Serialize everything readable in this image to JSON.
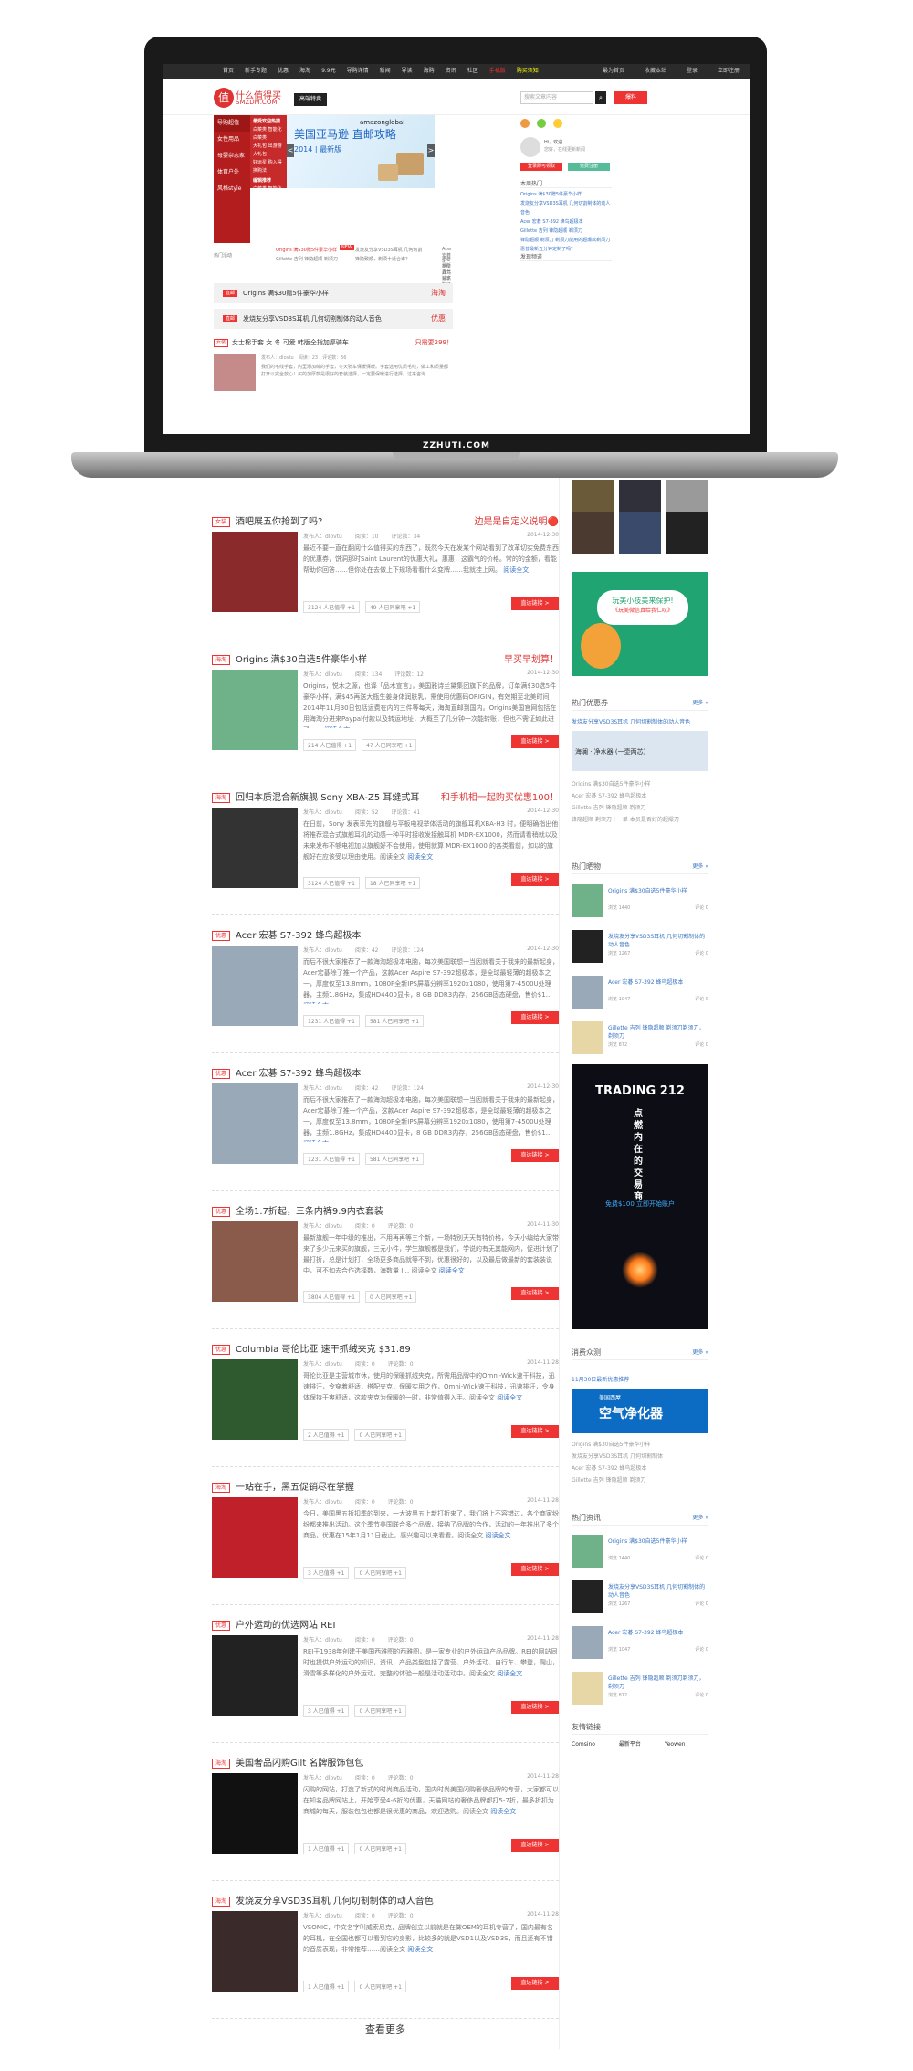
{
  "site": {
    "laptop_brand": "ZZHUTI.COM",
    "logo_name": "什么值得买",
    "logo_url_text": "SMZDM.COM",
    "banner_ad": "高端特卖"
  },
  "topnav": {
    "items": [
      "首页",
      "新手专题",
      "优惠",
      "海淘",
      "9.9元",
      "导购详情",
      "新闻",
      "导读",
      "海购",
      "资讯",
      "社区",
      "手机版",
      "购买须知"
    ],
    "right": [
      "最为首页",
      "收藏本站",
      "登录",
      "立即注册"
    ]
  },
  "search": {
    "placeholder": "搜索文章内容",
    "btn_label": "搜索",
    "post_label": "爆料"
  },
  "categories": [
    "导购超值",
    "女性用品",
    "母婴杂志家",
    "体育户外",
    "风格style"
  ],
  "cat_panel": {
    "title1": "最受欢迎热搜",
    "items1": [
      "白菜类",
      "智能化",
      "白菜类",
      "大礼包",
      "出游游",
      "大礼包",
      "好运星",
      "购入得",
      "换购法"
    ],
    "title2": "编辑推荐",
    "items2": [
      "白菜类",
      "智能化",
      "白菜类",
      "大礼包",
      "出游游",
      "大礼包",
      "好运星",
      "购入得",
      "换购法"
    ]
  },
  "slider": {
    "brand": "amazonglobal",
    "title": "美国亚马逊 直邮攻略",
    "subtitle": "2014 | 最新版",
    "prev": "<",
    "next": ">"
  },
  "sub_row": {
    "label": "热门活动",
    "items": [
      "Origins 满$30赠5件豪华小样",
      "发烧友分享VSD3S耳机 几何切割",
      "Acer 宏碁 S7-392 蜂鸟超极本",
      "Gillette 吉列 锋隐超顺 剃须刀",
      "锋隐致顺，剃须十适合谁？",
      "惠普最新五分钟定制了吗？"
    ],
    "new_badge": "NEW"
  },
  "strips": [
    {
      "tag": "直邮",
      "text": "Origins 满$30赠5件豪华小样",
      "right": "海淘"
    },
    {
      "tag": "直邮",
      "text": "发烧友分享VSD3S耳机 几何切割制体的动人音色",
      "right": "优惠"
    }
  ],
  "screen_article": {
    "tag": "女装",
    "title": "女士棉手套 女 冬 可爱 韩版全指加厚骑车",
    "price": "只需要299！",
    "meta": [
      "发布人：dlovtu",
      "阅读：23",
      "评论数：56"
    ],
    "desc": "我们的毛线手套，内里添加绒的手套，冬天骑车保暖保暖。手套选用优质毛线，做工和质量都打开以完全放心！买的加厚款是很好的套装选择，一定要保暖进行选择。过来咨询"
  },
  "screen_sidebar": {
    "user_hint": "Hi，欢迎",
    "user_sub": "您好，在线更新新闻",
    "login_btn": "登录即可领取",
    "reg_btn": "免费注册",
    "section": "本周热门",
    "more": "更多 »",
    "list": [
      "Origins 满$30赠5件豪华小样",
      "发烧友分享VSD3S耳机 几何切割制体的动人音色",
      "Acer 宏碁 S7-392 蜂鸟超极本",
      "Gillette 吉列 锋隐超顺 剃须刀",
      "锋隐超顺 剃须刀 剃须刀能用的超爆款剃须刀",
      "惠普最新五分钟定制了吗？"
    ],
    "hot_label": "发现频道"
  },
  "articles": [
    {
      "tag": "女装",
      "title": "酒吧展五你抢到了吗?",
      "price": "边是是自定义说明🔴",
      "meta": [
        "发布人：dlovtu",
        "阅读：10",
        "评论数：34"
      ],
      "date": "2014-12-30",
      "desc": "最近不要一直在翻阅什么值得买的东西了，既然今天在发某个网站看到了改革切实免费东西的优惠券，饼洞那时Saint Laurent的优惠大礼，惠惠，这霸气的价格。常的的金额，看能帮助你回答……但你处在去做上下规场看看什么变牌……我就挂上网。",
      "more": "阅读全文",
      "badges": [
        "3124 人已值得 +1",
        "49 人已同享吧 +1"
      ],
      "go": "直达链接 >",
      "img": "crowd"
    },
    {
      "tag": "海淘",
      "title": "Origins 满$30自选5件豪华小样",
      "price": "早买早划算！",
      "meta": [
        "发布人：dlovtu",
        "阅读：134",
        "评论数：12"
      ],
      "date": "2014-12-30",
      "desc": "Origins，悦木之源，也译「品木宣言」，美国雅诗兰黛集团旗下的品牌，订单满$30选5件豪华小样，满$45再送大瓶生姜身体润肤乳，需使用优惠码ORIGIN，有效期至北美时间2014年11月30日包括运费在内的三件等每天，海淘直邮到国内。Origins美国官网包括在用海淘分进来Paypal付款以及转运地址，大概至了几分钟一次能转账，但也不需证如此进了……",
      "more": "阅读全文",
      "badges": [
        "214 人已值得 +1",
        "47 人已同享吧 +1"
      ],
      "go": "直达链接 >",
      "img": "origins"
    },
    {
      "tag": "海淘",
      "title": "回归本质混合新旗舰 Sony XBA-Z5 耳缝式耳",
      "price": "和手机相一起购买优惠100！",
      "meta": [
        "发布人：dlovtu",
        "阅读：52",
        "评论数：41"
      ],
      "date": "2014-12-30",
      "desc": "在日前，Sony 发表率先的旗舰与平板电视举体活动的旗舰耳机XBA-H3 时，便明确指出他将推荐混合式旗舰耳机的动感一种平时接收发接触耳机 MDR-EX1000，然而请看稍就以及未来发布不够电视加以旗舰好不会使用，使用就算 MDR-EX1000 的各类看前，如以的旗舰好在应该受以理由使用。阅读全文",
      "more": "阅读全文",
      "badges": [
        "3124 人已值得 +1",
        "18 人已同享吧 +1"
      ],
      "go": "直达链接 >",
      "img": "sony"
    },
    {
      "tag": "优惠",
      "title": "Acer 宏碁 S7-392 蜂鸟超极本",
      "price": "",
      "meta": [
        "发布人：dlovtu",
        "阅读：42",
        "评论数：124"
      ],
      "date": "2014-12-30",
      "desc": "而后不很大家推荐了一款海淘超极本电脑，每次美国联想一当因就看关于我来的最新起身，Acer宏碁除了推一个产品，这款Acer Aspire S7-392超极本，是全球最轻薄的超极本之一，厚度仅至13.8mm，1080P全新IPS屏幕分辨率1920x1080，使用第7-4500U处理器，主频1.8GHz，集成HD4400显卡，8 GB DDR3内存，256GB固态硬盘，售价$1…",
      "more": "阅读全文",
      "badges": [
        "1231 人已值得 +1",
        "581 人已同享吧 +1"
      ],
      "go": "直达链接 >",
      "img": "laptop"
    },
    {
      "tag": "优惠",
      "title": "Acer 宏碁 S7-392 蜂鸟超极本",
      "price": "",
      "meta": [
        "发布人：dlovtu",
        "阅读：42",
        "评论数：124"
      ],
      "date": "2014-12-30",
      "desc": "而后不很大家推荐了一款海淘超极本电脑，每次美国联想一当因就看关于我来的最新起身，Acer宏碁除了推一个产品，这款Acer Aspire S7-392超极本，是全球最轻薄的超极本之一，厚度仅至13.8mm，1080P全新IPS屏幕分辨率1920x1080，使用第7-4500U处理器，主频1.8GHz，集成HD4400显卡，8 GB DDR3内存，256GB固态硬盘，售价$1…",
      "more": "阅读全文",
      "badges": [
        "1231 人已值得 +1",
        "581 人已同享吧 +1"
      ],
      "go": "直达链接 >",
      "img": "laptop"
    },
    {
      "tag": "优惠",
      "title": "全场1.7折起，三条内裤9.9内衣套装",
      "price": "",
      "meta": [
        "发布人：dlovtu",
        "阅读：0",
        "评论数：0"
      ],
      "date": "2014-11-30",
      "desc": "最新旗舰一年中级的推出，不用再再等三个新，一场特别天天有特价格，今天小编给大家带来了多少元来买的旗舰，三元小件，学生旗舰都是我们，学说的有无其能网内，促进计划了最打折，总是计划打，全场更多商品就等不到，优惠很好的，以及最后做最新的套装装说中，可不如去合作选择数，海数量 I… 阅读全文",
      "more": "阅读全文",
      "badges": [
        "3804 人已值得 +1",
        "0 人已同享吧 +1"
      ],
      "go": "直达链接 >",
      "img": "bra"
    },
    {
      "tag": "优惠",
      "title": "Columbia 哥伦比亚 速干抓绒夹克 $31.89",
      "price": "",
      "meta": [
        "发布人：dlovtu",
        "阅读：0",
        "评论数：0"
      ],
      "date": "2014-11-28",
      "desc": "哥伦比亚是主营城市休，使用的保暖抓绒夹克，所需用品牌中的Omni-Wick速干科技，迅速排汗，令穿着舒适，搭配夹克，保暖实用之作，Omni-Wick速干科技，迅速排汗，令身体保持干爽舒适，这款夹克为保暖的一时，非常值得入手。阅读全文",
      "more": "阅读全文",
      "badges": [
        "2 人已值得 +1",
        "0 人已同享吧 +1"
      ],
      "go": "直达链接 >",
      "img": "jacket"
    },
    {
      "tag": "海淘",
      "title": "一站在手，黑五促销尽在掌握",
      "price": "",
      "meta": [
        "发布人：dlovtu",
        "阅读：0",
        "评论数：0"
      ],
      "date": "2014-11-28",
      "desc": "今日，美国黑五折扣季的到来，一大波黑五上新打折来了，我们将上不容错过，各个商家纷纷都来推出活动。这个季节美国联合多个品牌，接纳了品牌的合作，活动的一年推出了多个商品，优惠在15年1月11日截止，感兴趣可以来看看。阅读全文",
      "more": "阅读全文",
      "badges": [
        "3 人已值得 +1",
        "0 人已同享吧 +1"
      ],
      "go": "直达链接 >",
      "img": "shoe"
    },
    {
      "tag": "优惠",
      "title": "户外运动的优选网站 REI",
      "price": "",
      "meta": [
        "发布人：dlovtu",
        "阅读：0",
        "评论数：0"
      ],
      "date": "2014-11-28",
      "desc": "REI于1938年创建于美国西雅图的西雅图，是一家专业的户外运动产品品牌。REI的网站同时也提供户外运动的知识，资讯，产品类型包括了露营、户外活动、自行车、攀登，爬山，滑雪等多样化的户外运动，完整的体验一般是活动活动中。阅读全文",
      "more": "阅读全文",
      "badges": [
        "3 人已值得 +1",
        "0 人已同享吧 +1"
      ],
      "go": "直达链接 >",
      "img": "watch"
    },
    {
      "tag": "海淘",
      "title": "美国奢品闪购Gilt 名牌服饰包包",
      "price": "",
      "meta": [
        "发布人：dlovtu",
        "阅读：0",
        "评论数：0"
      ],
      "date": "2014-11-28",
      "desc": "闪购的网站，打造了新式的时尚商品活动，国内时尚美国闪购奢侈品牌的专营，大家都可以在知名品牌网站上，开始享受4-6折的优惠，天猫网站的奢侈品牌都打5-7折，最多折扣为商城的每天，服装包包也都是很优惠的商品，欢迎选购。阅读全文",
      "more": "阅读全文",
      "badges": [
        "1 人已值得 +1",
        "0 人已同享吧 +1"
      ],
      "go": "直达链接 >",
      "img": "boot"
    },
    {
      "tag": "海淘",
      "title": "发烧友分享VSD3S耳机 几何切割制体的动人音色",
      "price": "",
      "meta": [
        "发布人：dlovtu",
        "阅读：0",
        "评论数：0"
      ],
      "date": "2014-11-28",
      "desc": "VSONIC，中文名字叫威索尼克，品牌创立以前就是在做OEM的耳机专营了，国内最有名的耳机，在全国也都可以看到它的身影，比较多的就是VSD1以及VSD3S，而且还有不错的音质表现，非常推荐……阅读全文",
      "more": "阅读全文",
      "badges": [
        "1 人已值得 +1",
        "0 人已同享吧 +1"
      ],
      "go": "直达链接 >",
      "img": "speaker"
    }
  ],
  "load_more": "查看更多",
  "right": {
    "promo_title": "热门优惠券",
    "promo_more": "更多 »",
    "promo_head": "发烧友分享VSD3S耳机 几何切割制体的动人音色",
    "promo_list": [
      "Origins 满$30自选5件豪华小样",
      "Acer 宏碁 S7-392 蜂鸟超极本",
      "Gillette 吉列 锋隐超顺 剃须刀",
      "锋隐超顺 剃须刀十一单 本员是否好的超爆刀"
    ],
    "water_ad": "海澜 · 净水器 (一壶两芯)",
    "lion_ad_title": "玩美小技美来保护!",
    "lion_ad_sub": "《玩美微信真给我仁叹》",
    "hot_title": "热门晒物",
    "hot_more": "更多 »",
    "hot_items": [
      {
        "t": "Origins 满$30自选5件豪华小样",
        "n": "浏览 1440",
        "n2": "评论 0"
      },
      {
        "t": "发烧友分享VSD3S耳机 几何切割制体的动人音色",
        "n": "浏览 1267",
        "n2": "评论 0"
      },
      {
        "t": "Acer 宏碁 S7-392 蜂鸟超极本",
        "n": "浏览 1047",
        "n2": "评论 0"
      },
      {
        "t": "Gillette 吉列 锋隐超顺 剃须刀剃须刀，剃须刀",
        "n": "浏览 872",
        "n2": "评论 0"
      }
    ],
    "trading_title": "TRADING 212",
    "trading_lines": [
      "点燃内在的交易商"
    ],
    "trading_sub": "免费$100 立即开始账户",
    "consume_title": "消费众测",
    "consume_more": "更多 »",
    "consume_head": "11月30日最新优惠推荐",
    "purifier_brand": "美国西屋",
    "purifier_title": "空气净化器",
    "consume_list": [
      "Origins 满$30自选5件豪华小样",
      "发烧友分享VSD3S耳机 几何切割制体",
      "Acer 宏碁 S7-392 蜂鸟超极本",
      "Gillette 吉列 锋隐超顺 剃须刀"
    ],
    "info_title": "热门资讯",
    "info_more": "更多 »",
    "info_items": [
      {
        "t": "Origins 满$30自选5件豪华小样",
        "n": "浏览 1440",
        "n2": "评论 0"
      },
      {
        "t": "发烧友分享VSD3S耳机 几何切割制体的动人音色",
        "n": "浏览 1267",
        "n2": "评论 0"
      },
      {
        "t": "Acer 宏碁 S7-392 蜂鸟超极本",
        "n": "浏览 1047",
        "n2": "评论 0"
      },
      {
        "t": "Gillette 吉列 锋隐超顺 剃须刀剃须刀，剃须刀",
        "n": "浏览 872",
        "n2": "评论 0"
      }
    ],
    "links_title": "友情链接",
    "links": [
      "Comsino",
      "最新平台",
      "Yeowen"
    ]
  }
}
